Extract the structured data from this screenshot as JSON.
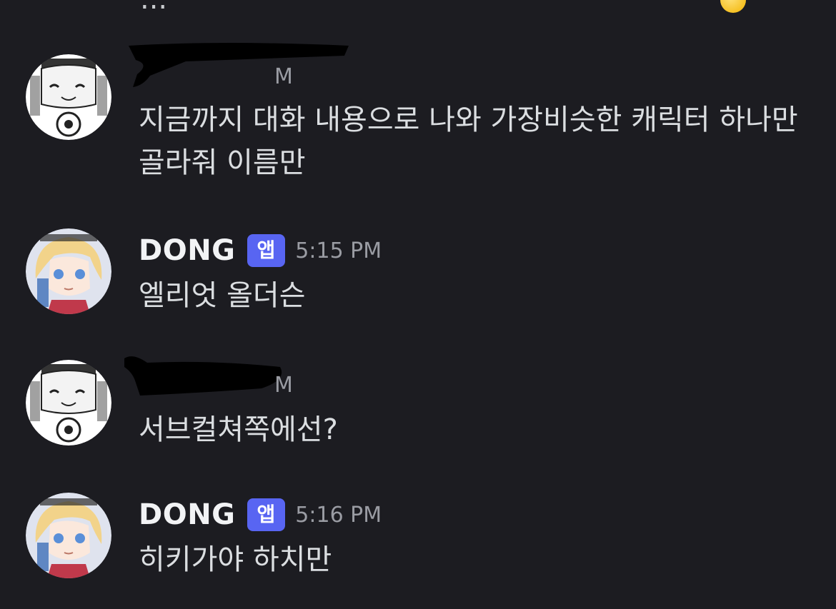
{
  "top_fragment": {
    "text": "...",
    "emoji": "face-emoji"
  },
  "messages": [
    {
      "author_redacted": true,
      "timestamp_fragment": "M",
      "avatar": "user-avatar-sketch",
      "content": "지금까지 대화 내용으로 나와 가장비슷한 캐릭터 하나만 골라줘 이름만"
    },
    {
      "author": "DONG",
      "badge": "앱",
      "timestamp": "5:15 PM",
      "avatar": "bot-avatar-blonde",
      "content": "엘리엇 올더슨"
    },
    {
      "author_redacted": true,
      "timestamp_fragment": "M",
      "avatar": "user-avatar-sketch",
      "content": "서브컬쳐쪽에선?"
    },
    {
      "author": "DONG",
      "badge": "앱",
      "timestamp": "5:16 PM",
      "avatar": "bot-avatar-blonde",
      "content": "히키가야 하치만"
    }
  ],
  "colors": {
    "background": "#1c1c21",
    "badge": "#5865f2",
    "text": "#dbdee1",
    "timestamp": "#9a9ca3"
  }
}
